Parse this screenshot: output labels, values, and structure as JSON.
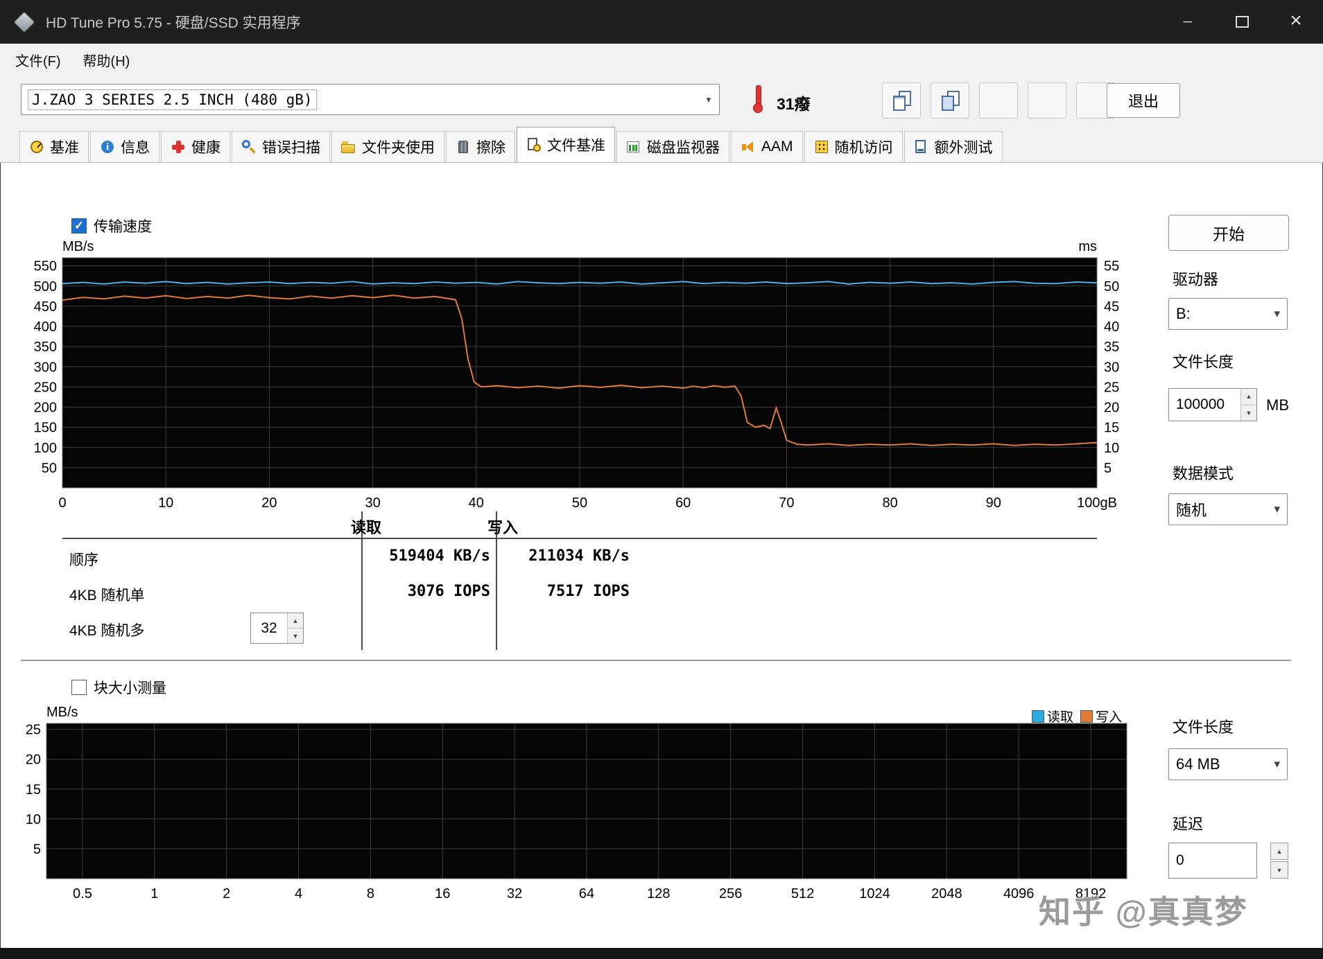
{
  "titlebar": {
    "app_title": "HD Tune Pro 5.75 - 硬盘/SSD 实用程序",
    "controls": [
      "minimize",
      "maximize",
      "close"
    ]
  },
  "menubar": {
    "items": [
      "文件(F)",
      "帮助(H)"
    ]
  },
  "toolbar": {
    "device_dropdown": {
      "value": "J.ZAO 3 SERIES 2.5 INCH (480 gB)"
    },
    "temperature": {
      "icon": "thermometer-icon",
      "value": "31癈"
    },
    "buttons": [
      {
        "name": "copy-text",
        "icon": "copy-text-icon"
      },
      {
        "name": "copy-image",
        "icon": "copy-image-icon"
      },
      {
        "name": "screenshot",
        "icon": "camera-icon"
      },
      {
        "name": "performance",
        "icon": "speed-icon"
      },
      {
        "name": "save-results",
        "icon": "download-icon"
      }
    ],
    "exit_button": "退出"
  },
  "tabs": {
    "active": "文件基准",
    "items": [
      {
        "label": "基准",
        "icon": "gauge"
      },
      {
        "label": "信息",
        "icon": "info"
      },
      {
        "label": "健康",
        "icon": "health"
      },
      {
        "label": "错误扫描",
        "icon": "scan"
      },
      {
        "label": "文件夹使用",
        "icon": "folder"
      },
      {
        "label": "擦除",
        "icon": "erase"
      },
      {
        "label": "文件基准",
        "icon": "file-benchmark"
      },
      {
        "label": "磁盘监视器",
        "icon": "disk-monitor"
      },
      {
        "label": "AAM",
        "icon": "aam"
      },
      {
        "label": "随机访问",
        "icon": "random-access"
      },
      {
        "label": "额外测试",
        "icon": "extra-tests"
      }
    ]
  },
  "transfer_section": {
    "checkbox_label": "传输速度",
    "checked": true
  },
  "results": {
    "read_header": "读取",
    "write_header": "写入",
    "rows": [
      {
        "label": "顺序",
        "read": "519404 KB/s",
        "write": "211034 KB/s"
      },
      {
        "label": "4KB 随机单",
        "read": "3076 IOPS",
        "write": "7517 IOPS"
      },
      {
        "label": "4KB 随机多",
        "read": "",
        "write": ""
      }
    ],
    "thread_spinner": "32"
  },
  "block_section": {
    "checkbox_label": "块大小测量",
    "checked": false,
    "legend": [
      {
        "label": "读取",
        "color": "#29abe2"
      },
      {
        "label": "写入",
        "color": "#e07b35"
      }
    ]
  },
  "side_panel": {
    "start_button": "开始",
    "drive_label": "驱动器",
    "drive_value": "B:",
    "file_length_label": "文件长度",
    "file_length_value": "100000",
    "file_length_unit": "MB",
    "data_mode_label": "数据模式",
    "data_mode_value": "随机",
    "block_file_length_label": "文件长度",
    "block_file_length_value": "64 MB",
    "delay_label": "延迟",
    "delay_value": "0"
  },
  "watermark": "知乎 @真真梦",
  "chart_data": [
    {
      "type": "line",
      "title": "传输速度",
      "background": "#050505",
      "grid": true,
      "x_axis": {
        "min": 0,
        "max": 100,
        "ticks": [
          0,
          10,
          20,
          30,
          40,
          50,
          60,
          70,
          80,
          90,
          100
        ],
        "tick_labels": [
          "0",
          "10",
          "20",
          "30",
          "40",
          "50",
          "60",
          "70",
          "80",
          "90",
          "100gB"
        ]
      },
      "y_left": {
        "label": "MB/s",
        "min": 0,
        "max": 570,
        "ticks": [
          550,
          500,
          450,
          400,
          350,
          300,
          250,
          200,
          150,
          100,
          50
        ]
      },
      "y_right": {
        "label": "ms",
        "min": 0,
        "max": 57,
        "ticks": [
          55,
          50,
          45,
          40,
          35,
          30,
          25,
          20,
          15,
          10,
          5
        ]
      },
      "series": [
        {
          "name": "写入",
          "color": "#e07b35",
          "axis": "left",
          "points": [
            [
              0,
              465
            ],
            [
              2,
              472
            ],
            [
              4,
              468
            ],
            [
              6,
              475
            ],
            [
              8,
              470
            ],
            [
              10,
              476
            ],
            [
              12,
              469
            ],
            [
              14,
              474
            ],
            [
              16,
              470
            ],
            [
              18,
              477
            ],
            [
              20,
              471
            ],
            [
              22,
              468
            ],
            [
              24,
              475
            ],
            [
              26,
              470
            ],
            [
              28,
              476
            ],
            [
              30,
              471
            ],
            [
              32,
              477
            ],
            [
              34,
              470
            ],
            [
              36,
              474
            ],
            [
              37,
              470
            ],
            [
              38,
              466
            ],
            [
              38.6,
              420
            ],
            [
              39.2,
              320
            ],
            [
              39.8,
              262
            ],
            [
              40.5,
              250
            ],
            [
              42,
              253
            ],
            [
              44,
              248
            ],
            [
              46,
              252
            ],
            [
              48,
              247
            ],
            [
              50,
              253
            ],
            [
              52,
              249
            ],
            [
              54,
              254
            ],
            [
              56,
              248
            ],
            [
              58,
              252
            ],
            [
              60,
              247
            ],
            [
              61,
              252
            ],
            [
              62,
              248
            ],
            [
              63,
              253
            ],
            [
              64,
              249
            ],
            [
              65,
              252
            ],
            [
              65.6,
              228
            ],
            [
              66.2,
              162
            ],
            [
              67,
              150
            ],
            [
              67.8,
              155
            ],
            [
              68.4,
              147
            ],
            [
              69,
              198
            ],
            [
              69.5,
              160
            ],
            [
              70,
              118
            ],
            [
              71,
              108
            ],
            [
              72,
              106
            ],
            [
              74,
              109
            ],
            [
              76,
              105
            ],
            [
              78,
              108
            ],
            [
              80,
              106
            ],
            [
              82,
              109
            ],
            [
              84,
              105
            ],
            [
              86,
              108
            ],
            [
              88,
              106
            ],
            [
              90,
              109
            ],
            [
              92,
              105
            ],
            [
              94,
              108
            ],
            [
              96,
              106
            ],
            [
              98,
              109
            ],
            [
              100,
              112
            ]
          ]
        },
        {
          "name": "读取",
          "color": "#46b4e8",
          "axis": "left",
          "points": [
            [
              0,
              506
            ],
            [
              2,
              509
            ],
            [
              4,
              505
            ],
            [
              6,
              510
            ],
            [
              8,
              507
            ],
            [
              10,
              511
            ],
            [
              12,
              506
            ],
            [
              14,
              509
            ],
            [
              16,
              505
            ],
            [
              18,
              508
            ],
            [
              20,
              510
            ],
            [
              22,
              506
            ],
            [
              24,
              509
            ],
            [
              26,
              507
            ],
            [
              28,
              511
            ],
            [
              30,
              505
            ],
            [
              32,
              508
            ],
            [
              34,
              506
            ],
            [
              36,
              510
            ],
            [
              38,
              507
            ],
            [
              40,
              509
            ],
            [
              42,
              505
            ],
            [
              44,
              511
            ],
            [
              46,
              508
            ],
            [
              48,
              506
            ],
            [
              50,
              509
            ],
            [
              52,
              507
            ],
            [
              54,
              510
            ],
            [
              56,
              505
            ],
            [
              58,
              508
            ],
            [
              60,
              511
            ],
            [
              62,
              506
            ],
            [
              64,
              509
            ],
            [
              66,
              507
            ],
            [
              68,
              510
            ],
            [
              70,
              506
            ],
            [
              72,
              508
            ],
            [
              74,
              511
            ],
            [
              76,
              505
            ],
            [
              78,
              509
            ],
            [
              80,
              507
            ],
            [
              82,
              510
            ],
            [
              84,
              506
            ],
            [
              86,
              508
            ],
            [
              88,
              505
            ],
            [
              90,
              509
            ],
            [
              92,
              511
            ],
            [
              94,
              507
            ],
            [
              96,
              506
            ],
            [
              98,
              510
            ],
            [
              100,
              508
            ]
          ]
        }
      ]
    },
    {
      "type": "line",
      "title": "块大小测量",
      "background": "#050505",
      "grid": true,
      "legend_position": "top-right",
      "x_axis": {
        "tick_labels": [
          "0.5",
          "1",
          "2",
          "4",
          "8",
          "16",
          "32",
          "64",
          "128",
          "256",
          "512",
          "1024",
          "2048",
          "4096",
          "8192"
        ]
      },
      "y_left": {
        "label": "MB/s",
        "min": 0,
        "max": 26,
        "ticks": [
          25,
          20,
          15,
          10,
          5
        ]
      },
      "series": [
        {
          "name": "读取",
          "color": "#29abe2",
          "points": []
        },
        {
          "name": "写入",
          "color": "#e07b35",
          "points": []
        }
      ]
    }
  ]
}
